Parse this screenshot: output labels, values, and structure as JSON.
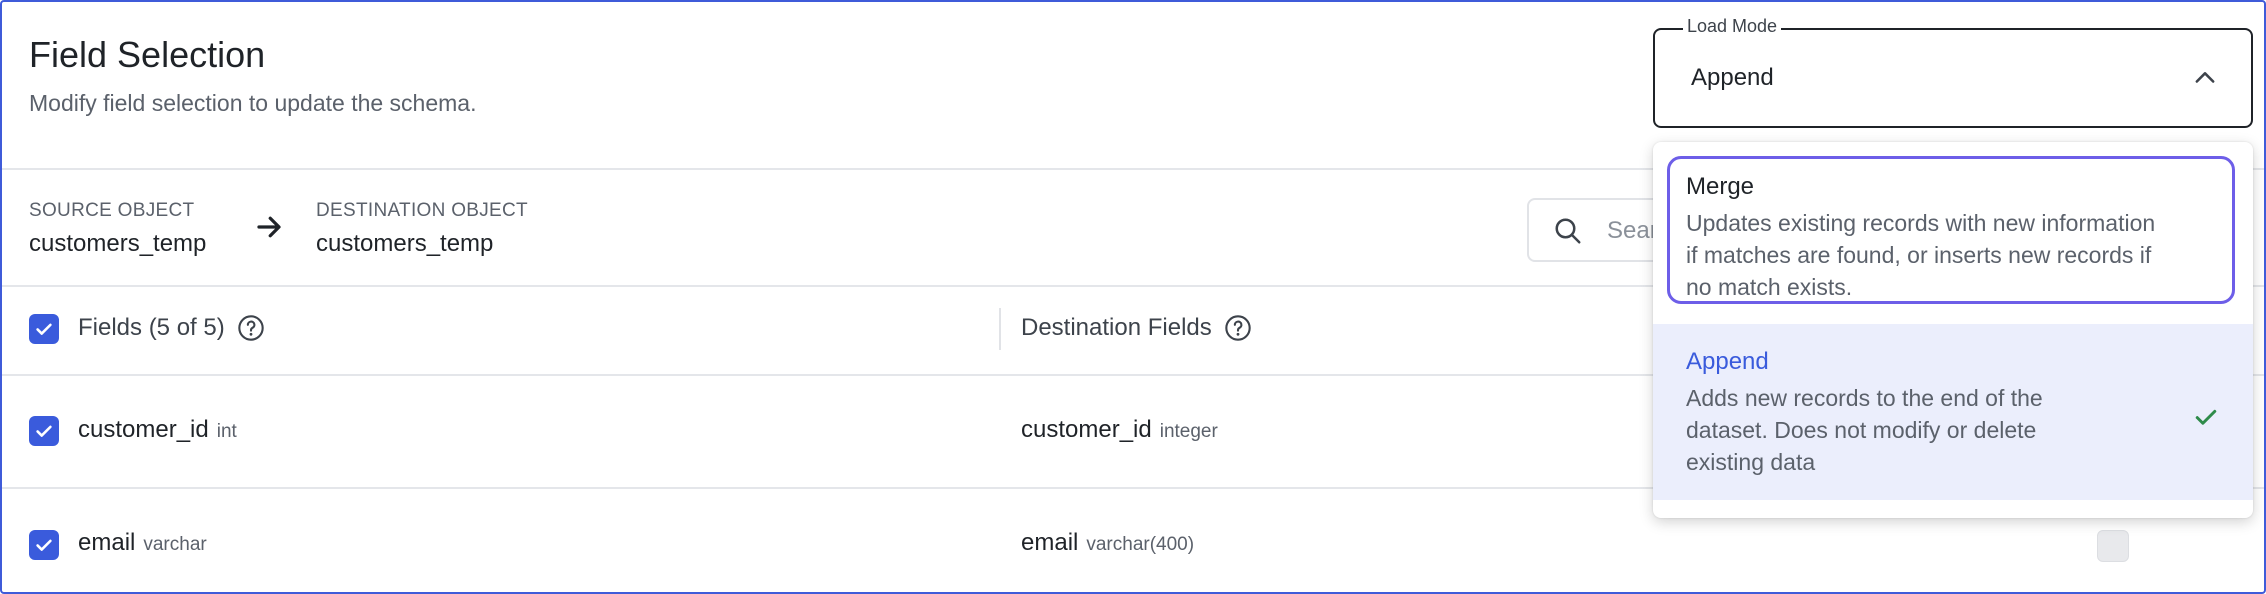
{
  "header": {
    "title": "Field Selection",
    "subtitle": "Modify field selection to update the schema."
  },
  "mapping": {
    "source_label": "SOURCE OBJECT",
    "source_value": "customers_temp",
    "destination_label": "DESTINATION OBJECT",
    "destination_value": "customers_temp"
  },
  "search": {
    "placeholder": "Sear"
  },
  "table": {
    "fields_header": "Fields (5 of 5)",
    "destination_header": "Destination Fields",
    "rows": [
      {
        "name": "customer_id",
        "type": "int",
        "dest_name": "customer_id",
        "dest_type": "integer",
        "selected": true
      },
      {
        "name": "email",
        "type": "varchar",
        "dest_name": "email",
        "dest_type": "varchar(400)",
        "selected": true
      }
    ]
  },
  "load_mode": {
    "label": "Load Mode",
    "value": "Append",
    "options": [
      {
        "title": "Merge",
        "description_lines": [
          "Updates existing records with new information",
          "if matches are found, or inserts new records if",
          "no match exists."
        ],
        "focused": true
      },
      {
        "title": "Append",
        "description_lines": [
          "Adds new records to the end of the",
          "dataset. Does not modify or delete",
          "existing data"
        ],
        "selected": true
      }
    ]
  },
  "colors": {
    "accent": "#3a5bdc",
    "focus_ring": "#6d5ee8",
    "selected_bg": "#ebeefc",
    "check_green": "#2e8b4a"
  },
  "icons": [
    "arrow-right-icon",
    "search-icon",
    "help-circle-icon",
    "checkbox-checked-icon",
    "chevron-up-icon",
    "checkmark-icon"
  ]
}
